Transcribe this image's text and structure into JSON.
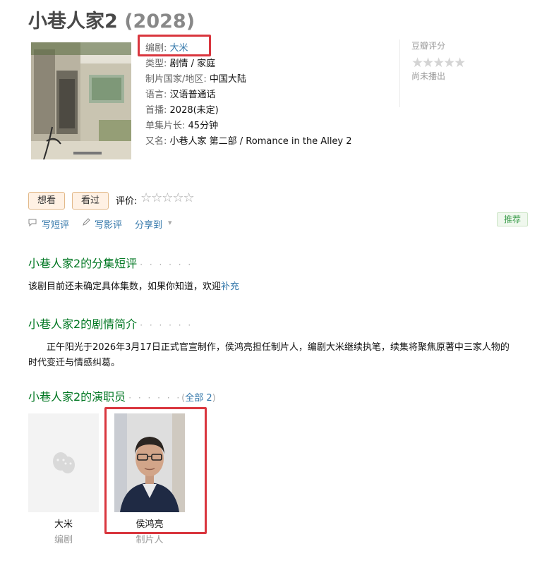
{
  "header": {
    "title": "小巷人家2",
    "year": "(2028)"
  },
  "info": {
    "writer_label": "编剧:",
    "writer": "大米",
    "genre_label": "类型:",
    "genre": "剧情 / 家庭",
    "country_label": "制片国家/地区:",
    "country": "中国大陆",
    "language_label": "语言:",
    "language": "汉语普通话",
    "premiere_label": "首播:",
    "premiere": "2028(未定)",
    "runtime_label": "单集片长:",
    "runtime": "45分钟",
    "aka_label": "又名:",
    "aka": "小巷人家 第二部 / Romance in the Alley 2"
  },
  "rating": {
    "label": "豆瓣评分",
    "stars": "★★★★★",
    "status": "尚未播出"
  },
  "actions": {
    "want": "想看",
    "watched": "看过",
    "rate_label": "评价:",
    "rate_stars": "☆☆☆☆☆",
    "short_review": "写短评",
    "review": "写影评",
    "share": "分享到",
    "share_arrow": "▾",
    "recommend": "推荐"
  },
  "episodes": {
    "title": "小巷人家2的分集短评",
    "dots": "· · · · · ·",
    "text": "该剧目前还未确定具体集数，如果你知道，欢迎",
    "link": "补充"
  },
  "synopsis": {
    "title": "小巷人家2的剧情简介",
    "dots": "· · · · · ·",
    "line1": "正午阳光于2026年3月17日正式官宣制作，侯鸿亮担任制片人，编剧大米继续执笔，续集将聚焦原著中三家人物的",
    "line2": "时代变迁与情感纠葛。"
  },
  "cast": {
    "title": "小巷人家2的演职员",
    "dots": "· · · · · ·",
    "paren_open": "(",
    "all": "全部 2",
    "paren_close": ")",
    "members": [
      {
        "name": "大米",
        "role": "编剧"
      },
      {
        "name": "侯鸿亮",
        "role": "制片人"
      }
    ]
  },
  "colors": {
    "highlight": "#d9363e",
    "link": "#3377aa",
    "section": "#007722"
  }
}
